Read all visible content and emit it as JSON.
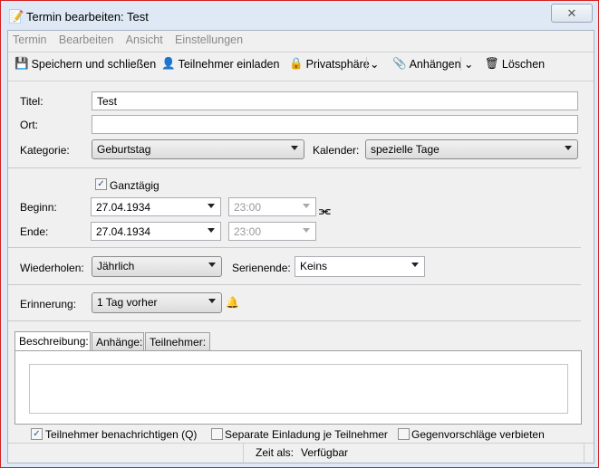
{
  "window": {
    "title": "Termin bearbeiten: Test",
    "close_icon": "close-icon"
  },
  "menu": [
    "Termin",
    "Bearbeiten",
    "Ansicht",
    "Einstellungen"
  ],
  "toolbar": {
    "save": "Speichern und schließen",
    "invite": "Teilnehmer einladen",
    "privacy": "Privatsphäre",
    "attach": "Anhängen",
    "delete": "Löschen"
  },
  "form": {
    "title_label": "Titel:",
    "title_value": "Test",
    "location_label": "Ort:",
    "location_value": "",
    "category_label": "Kategorie:",
    "category_value": "Geburtstag",
    "calendar_label": "Kalender:",
    "calendar_value": "spezielle Tage",
    "allday_label": "Ganztägig",
    "allday_checked": true,
    "start_label": "Beginn:",
    "start_date": "27.04.1934",
    "start_time": "23:00",
    "end_label": "Ende:",
    "end_date": "27.04.1934",
    "end_time": "23:00",
    "repeat_label": "Wiederholen:",
    "repeat_value": "Jährlich",
    "repeat_end_label": "Serienende:",
    "repeat_end_value": "Keins",
    "reminder_label": "Erinnerung:",
    "reminder_value": "1 Tag vorher"
  },
  "tabs": [
    "Beschreibung:",
    "Anhänge:",
    "Teilnehmer:"
  ],
  "description": "",
  "options": {
    "notify": "Teilnehmer benachrichtigen (Q)",
    "notify_checked": true,
    "separate": "Separate Einladung je Teilnehmer",
    "separate_checked": false,
    "no_counter": "Gegenvorschläge verbieten",
    "no_counter_checked": false
  },
  "status": {
    "label": "Zeit als:",
    "value": "Verfügbar"
  }
}
